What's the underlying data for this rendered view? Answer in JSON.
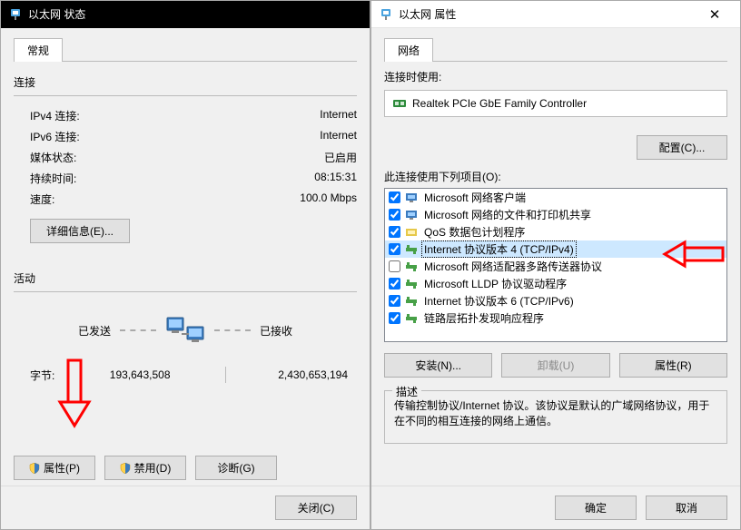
{
  "left": {
    "title": "以太网 状态",
    "tab": "常规",
    "connection_header": "连接",
    "rows": {
      "ipv4": {
        "label": "IPv4 连接:",
        "value": "Internet"
      },
      "ipv6": {
        "label": "IPv6 连接:",
        "value": "Internet"
      },
      "media": {
        "label": "媒体状态:",
        "value": "已启用"
      },
      "duration": {
        "label": "持续时间:",
        "value": "08:15:31"
      },
      "speed": {
        "label": "速度:",
        "value": "100.0 Mbps"
      }
    },
    "details_btn": "详细信息(E)...",
    "activity_header": "活动",
    "sent_label": "已发送",
    "recv_label": "已接收",
    "bytes_label": "字节:",
    "bytes_sent": "193,643,508",
    "bytes_recv": "2,430,653,194",
    "btn_properties": "属性(P)",
    "btn_disable": "禁用(D)",
    "btn_diagnose": "诊断(G)",
    "btn_close": "关闭(C)"
  },
  "right": {
    "title": "以太网 属性",
    "tab": "网络",
    "connect_using": "连接时使用:",
    "adapter": "Realtek PCIe GbE Family Controller",
    "configure_btn": "配置(C)...",
    "items_label": "此连接使用下列项目(O):",
    "items": [
      {
        "checked": true,
        "label": "Microsoft 网络客户端",
        "icon": "client"
      },
      {
        "checked": true,
        "label": "Microsoft 网络的文件和打印机共享",
        "icon": "client"
      },
      {
        "checked": true,
        "label": "QoS 数据包计划程序",
        "icon": "service"
      },
      {
        "checked": true,
        "label": "Internet 协议版本 4 (TCP/IPv4)",
        "icon": "protocol",
        "selected": true
      },
      {
        "checked": false,
        "label": "Microsoft 网络适配器多路传送器协议",
        "icon": "protocol"
      },
      {
        "checked": true,
        "label": "Microsoft LLDP 协议驱动程序",
        "icon": "protocol"
      },
      {
        "checked": true,
        "label": "Internet 协议版本 6 (TCP/IPv6)",
        "icon": "protocol"
      },
      {
        "checked": true,
        "label": "链路层拓扑发现响应程序",
        "icon": "protocol"
      }
    ],
    "btn_install": "安装(N)...",
    "btn_uninstall": "卸载(U)",
    "btn_props": "属性(R)",
    "desc_header": "描述",
    "desc_text": "传输控制协议/Internet 协议。该协议是默认的广域网络协议，用于在不同的相互连接的网络上通信。",
    "btn_ok": "确定",
    "btn_cancel": "取消"
  }
}
